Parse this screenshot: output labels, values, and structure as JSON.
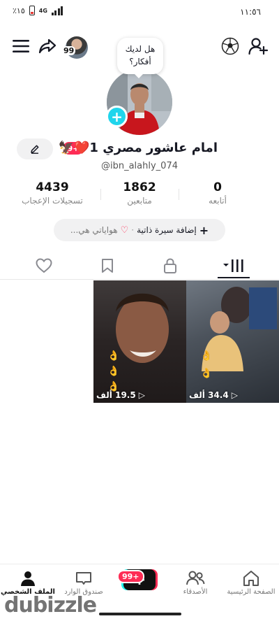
{
  "status_bar": {
    "time": "١١:٥٦",
    "battery_text": "٪١٥",
    "network": "4G"
  },
  "topbar": {
    "friends_badge": "99"
  },
  "profile": {
    "thought_bubble": "هل لديك أفكار؟",
    "display_name": "امام عاشور مصري 1❤️🦅",
    "notification_badge": "9+",
    "username": "@ibn_alahly_074"
  },
  "stats": [
    {
      "value": "0",
      "label": "أتابعه"
    },
    {
      "value": "1862",
      "label": "متابعين"
    },
    {
      "value": "4439",
      "label": "تسجيلات الإعجاب"
    }
  ],
  "bio": {
    "add_bio": "إضافة سيرة ذاتية",
    "separator": "·",
    "hobbies": "هواياتي هي..."
  },
  "videos": [
    {
      "views": "34.4 ألف"
    },
    {
      "views": "19.5 ألف"
    }
  ],
  "bottom_nav": {
    "home": "الصفحة الرئيسية",
    "friends": "الأصدقاء",
    "create": "+",
    "inbox": "صندوق الوارد",
    "inbox_badge": "99+",
    "profile": "الملف الشخصي"
  },
  "watermark": "dubizzle",
  "colors": {
    "accent_red": "#fe2c55",
    "accent_cyan": "#20d5ec"
  }
}
